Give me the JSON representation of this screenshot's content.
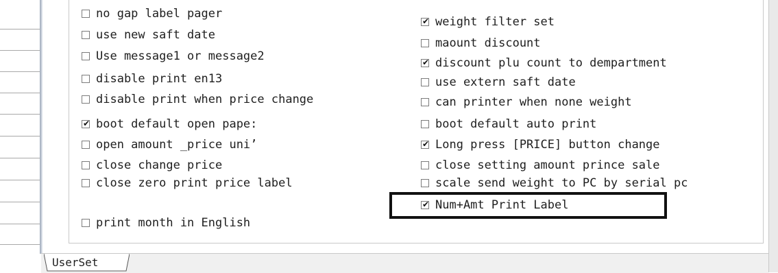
{
  "options_left": [
    {
      "label": "no gap label pager",
      "checked": false
    },
    {
      "label": "use new saft date",
      "checked": false
    },
    {
      "label": "Use message1 or message2",
      "checked": false
    },
    {
      "label": "disable print en13",
      "checked": false
    },
    {
      "label": "disable print when price change",
      "checked": false
    },
    {
      "label": "boot default open pape:",
      "checked": true
    },
    {
      "label": "open amount _price uni’",
      "checked": false
    },
    {
      "label": "close change price",
      "checked": false
    },
    {
      "label": "close zero print price label",
      "checked": false
    },
    {
      "label": "print month in English",
      "checked": false
    }
  ],
  "options_right": [
    {
      "label": "weight filter set",
      "checked": true
    },
    {
      "label": "maount discount",
      "checked": false
    },
    {
      "label": "discount plu count to dempartment",
      "checked": true
    },
    {
      "label": "use extern saft date",
      "checked": false
    },
    {
      "label": "can printer when none weight",
      "checked": false
    },
    {
      "label": "boot default auto print",
      "checked": false
    },
    {
      "label": "Long press [PRICE] button change",
      "checked": true
    },
    {
      "label": "close setting amount prince sale",
      "checked": false
    },
    {
      "label": "scale send weight to PC by serial pc",
      "checked": false
    },
    {
      "label": "Num+Amt Print Label",
      "checked": true
    }
  ],
  "check_glyph": "✔",
  "tabs": [
    {
      "label": "UserSet"
    }
  ]
}
